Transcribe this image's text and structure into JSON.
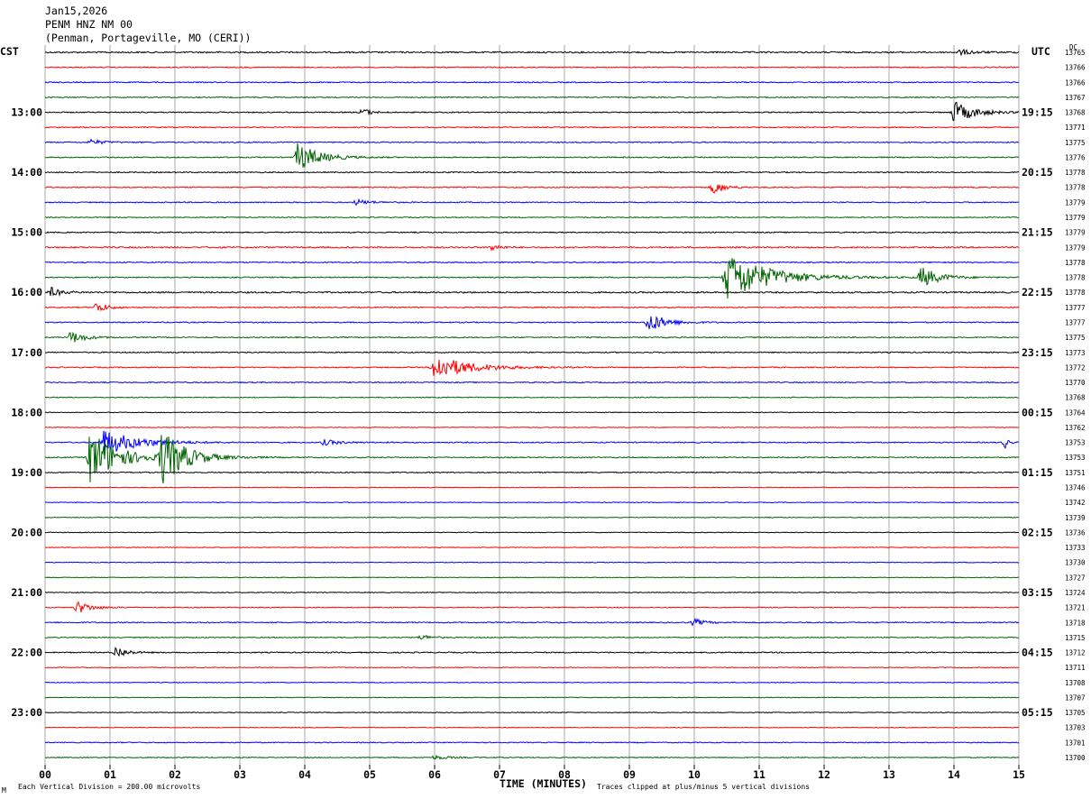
{
  "header": {
    "date": "Jan15,2026",
    "station": "PENM HNZ NM 00",
    "location": "(Penman, Portageville, MO (CERI))"
  },
  "left_zone": "CST",
  "right_zone": "UTC",
  "dc_label": "DC",
  "footer": {
    "scale_note": "Each Vertical Division =  200.00 microvolts",
    "clip_note": "Traces clipped at plus/minus 5 vertical divisions",
    "corner_mark": "M"
  },
  "chart_data": {
    "type": "line",
    "title": "PENM HNZ NM 00",
    "xlabel": "TIME (MINUTES)",
    "xlim": [
      0,
      15
    ],
    "x_ticks": [
      "00",
      "01",
      "02",
      "03",
      "04",
      "05",
      "06",
      "07",
      "08",
      "09",
      "10",
      "11",
      "12",
      "13",
      "14",
      "15"
    ],
    "trace_minutes": 15,
    "row_colors": [
      "#000000",
      "#ff0000",
      "#0000ff",
      "#006400"
    ],
    "left_time_labels": [
      "13:00",
      "14:00",
      "15:00",
      "16:00",
      "17:00",
      "18:00",
      "19:00",
      "20:00",
      "21:00",
      "22:00",
      "23:00"
    ],
    "right_time_labels": [
      "19:15",
      "20:15",
      "21:15",
      "22:15",
      "23:15",
      "00:15",
      "01:15",
      "02:15",
      "03:15",
      "04:15",
      "05:15"
    ],
    "dc_offsets": [
      13765,
      13766,
      13766,
      13767,
      13768,
      13771,
      13775,
      13776,
      13778,
      13778,
      13779,
      13779,
      13779,
      13779,
      13778,
      13778,
      13778,
      13777,
      13777,
      13775,
      13773,
      13772,
      13770,
      13768,
      13764,
      13762,
      13753,
      13753,
      13751,
      13746,
      13742,
      13739,
      13736,
      13733,
      13730,
      13727,
      13724,
      13721,
      13718,
      13715,
      13712,
      13711,
      13708,
      13707,
      13705,
      13703,
      13701,
      13700
    ],
    "noise_level": [
      0.8,
      0.6,
      0.6,
      0.6,
      0.6,
      0.6,
      0.6,
      0.6,
      0.6,
      0.6,
      0.6,
      0.5,
      0.6,
      0.8,
      0.6,
      0.6,
      0.8,
      0.6,
      0.6,
      0.6,
      0.6,
      0.6,
      0.6,
      0.5,
      0.4,
      0.4,
      0.6,
      0.6,
      0.6,
      0.4,
      0.4,
      0.4,
      0.4,
      0.4,
      0.4,
      0.4,
      0.4,
      0.5,
      0.6,
      0.5,
      0.6,
      0.4,
      0.4,
      0.4,
      0.4,
      0.4,
      0.5,
      0.5
    ],
    "events": [
      {
        "row": 0,
        "minute": 14.1,
        "amp": 3,
        "dur": 0.4
      },
      {
        "row": 4,
        "minute": 4.9,
        "amp": 5,
        "dur": 0.2
      },
      {
        "row": 4,
        "minute": 14.0,
        "amp": 12,
        "dur": 0.6
      },
      {
        "row": 6,
        "minute": 0.7,
        "amp": 3,
        "dur": 0.4
      },
      {
        "row": 7,
        "minute": 3.9,
        "amp": 16,
        "dur": 0.6
      },
      {
        "row": 9,
        "minute": 10.3,
        "amp": 8,
        "dur": 0.3
      },
      {
        "row": 10,
        "minute": 4.8,
        "amp": 3,
        "dur": 0.4
      },
      {
        "row": 13,
        "minute": 6.9,
        "amp": 4,
        "dur": 0.2
      },
      {
        "row": 15,
        "minute": 10.5,
        "amp": 28,
        "dur": 1.2
      },
      {
        "row": 15,
        "minute": 13.5,
        "amp": 12,
        "dur": 0.5
      },
      {
        "row": 16,
        "minute": 0.1,
        "amp": 5,
        "dur": 0.3
      },
      {
        "row": 17,
        "minute": 0.8,
        "amp": 6,
        "dur": 0.3
      },
      {
        "row": 18,
        "minute": 9.3,
        "amp": 11,
        "dur": 0.5
      },
      {
        "row": 19,
        "minute": 0.4,
        "amp": 7,
        "dur": 0.4
      },
      {
        "row": 21,
        "minute": 6.0,
        "amp": 14,
        "dur": 1.0
      },
      {
        "row": 26,
        "minute": 0.9,
        "amp": 14,
        "dur": 1.0
      },
      {
        "row": 26,
        "minute": 4.3,
        "amp": 3,
        "dur": 0.5
      },
      {
        "row": 26,
        "minute": 14.8,
        "amp": 6,
        "dur": 0.1
      },
      {
        "row": 27,
        "minute": 0.7,
        "amp": 30,
        "dur": 0.8
      },
      {
        "row": 27,
        "minute": 1.8,
        "amp": 30,
        "dur": 0.7
      },
      {
        "row": 37,
        "minute": 0.5,
        "amp": 7,
        "dur": 0.4
      },
      {
        "row": 38,
        "minute": 10.0,
        "amp": 4,
        "dur": 0.3
      },
      {
        "row": 39,
        "minute": 5.8,
        "amp": 3,
        "dur": 0.3
      },
      {
        "row": 40,
        "minute": 1.1,
        "amp": 7,
        "dur": 0.3
      },
      {
        "row": 47,
        "minute": 6.0,
        "amp": 2,
        "dur": 0.5
      }
    ]
  }
}
